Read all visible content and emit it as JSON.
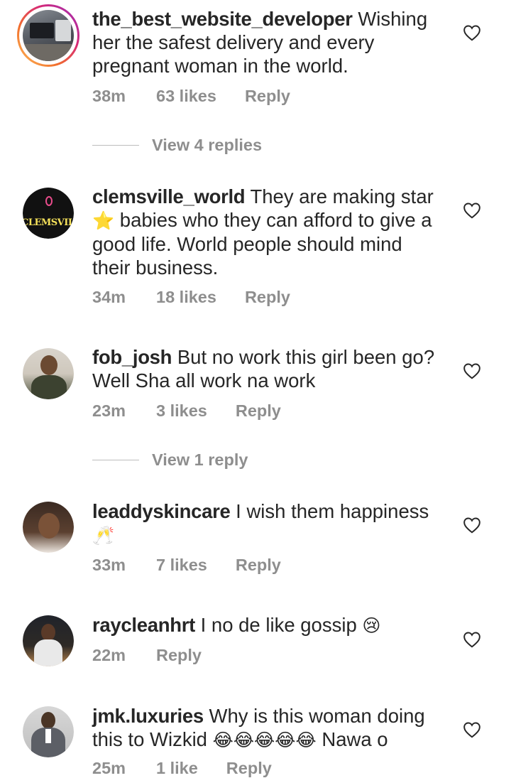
{
  "comments": [
    {
      "username": "the_best_website_developer",
      "text": "Wishing her the safest delivery and every pregnant woman in the world.",
      "time": "38m",
      "likes": "63 likes",
      "reply": "Reply",
      "view_replies": "View 4 replies"
    },
    {
      "username": "clemsville_world",
      "text_before": "They are making star",
      "emoji": "⭐",
      "text_after": "babies who they can afford to give a good life. World people should mind their business.",
      "time": "34m",
      "likes": "18 likes",
      "reply": "Reply",
      "avatar_text": "CLEMSVILLE"
    },
    {
      "username": "fob_josh",
      "text": "But no work this girl been go? Well Sha all work na work",
      "time": "23m",
      "likes": "3 likes",
      "reply": "Reply",
      "view_replies": "View 1 reply"
    },
    {
      "username": "leaddyskincare",
      "text": "I wish them happiness",
      "emoji": "🥂",
      "time": "33m",
      "likes": "7 likes",
      "reply": "Reply"
    },
    {
      "username": "raycleanhrt",
      "text": "I no de like gossip",
      "emoji": "😢",
      "time": "22m",
      "reply": "Reply"
    },
    {
      "username": "jmk.luxuries",
      "text": "Why is this woman doing this to Wizkid",
      "emoji": "😂😂😂😂😂",
      "text_after": "Nawa o",
      "time": "25m",
      "likes": "1 like",
      "reply": "Reply"
    }
  ],
  "icons": {
    "like": "heart-outline-icon"
  },
  "colors": {
    "muted": "#8e8e8e",
    "text": "#262626",
    "heart_stroke": "#262626"
  }
}
